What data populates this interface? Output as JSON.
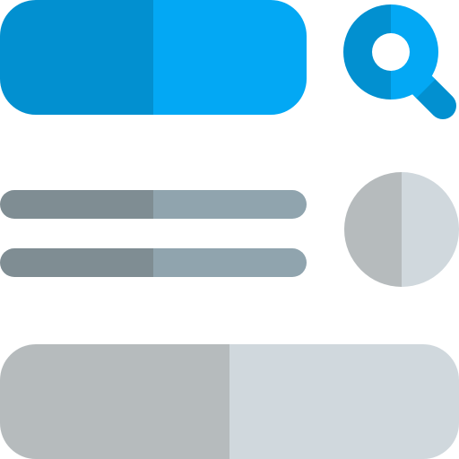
{
  "icon": {
    "name": "search-form-layout-icon",
    "colors": {
      "blue_dark": "#0290d0",
      "blue_light": "#03a8f4",
      "gray_dark": "#7f8d93",
      "gray_mid": "#90a4ae",
      "gray_light_dark": "#b6bbbd",
      "gray_light": "#d0d8dd",
      "lens_center": "#ffffff"
    }
  }
}
